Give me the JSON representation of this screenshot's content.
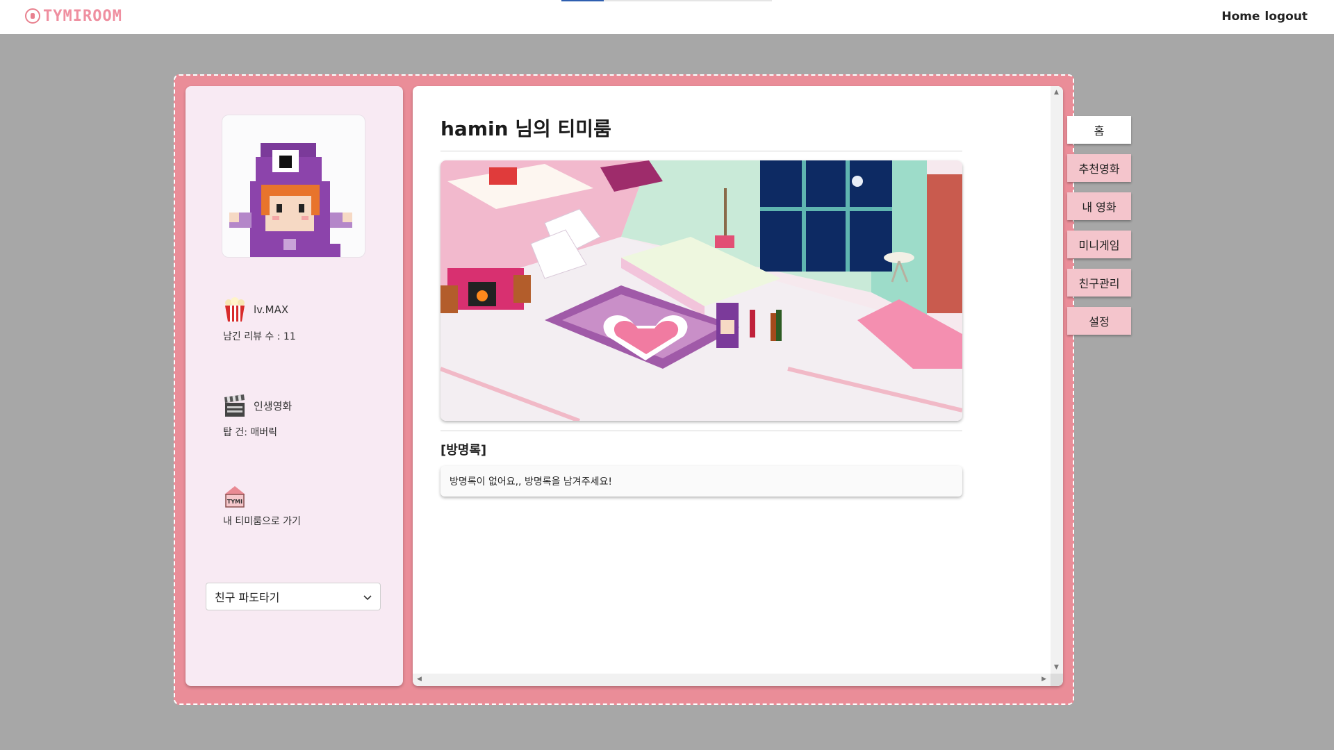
{
  "header": {
    "logo_text": "TYMIROOM",
    "nav": {
      "home": "Home",
      "logout": "logout"
    }
  },
  "profile": {
    "level": "lv.MAX",
    "review_count": "남긴 리뷰 수 : 11",
    "life_movie_label": "인생영화",
    "life_movie_value": "탑 건: 매버릭",
    "go_my_room_label": "내 티미룸으로 가기",
    "house_icon_text": "TYMI",
    "friend_select": "친구 파도타기"
  },
  "main": {
    "title": "hamin 님의 티미룸",
    "guestbook_title": "[방명록]",
    "guestbook_empty": "방명록이 없어요,, 방명록을 남겨주세요!"
  },
  "side_menu": [
    {
      "label": "홈",
      "active": true
    },
    {
      "label": "추천영화",
      "active": false
    },
    {
      "label": "내 영화",
      "active": false
    },
    {
      "label": "미니게임",
      "active": false
    },
    {
      "label": "친구관리",
      "active": false
    },
    {
      "label": "설정",
      "active": false
    }
  ],
  "colors": {
    "background": "#a7a7a7",
    "frame": "#ea8d98",
    "left_panel": "#f8eaf3",
    "tab": "#f4c5cc",
    "tab_active": "#ffffff",
    "logo": "#ef8fa0"
  },
  "icons": {
    "popcorn": "popcorn-icon",
    "clapperboard": "clapperboard-icon",
    "house": "house-icon",
    "chevron": "chevron-down-icon"
  }
}
